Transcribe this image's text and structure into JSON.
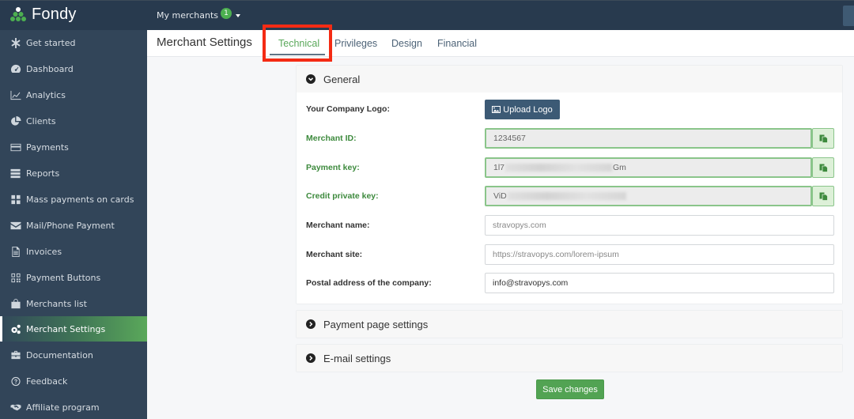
{
  "app": {
    "brand": "Fondy",
    "merchants_menu": {
      "label": "My merchants",
      "badge_count": "1"
    }
  },
  "sidebar": {
    "items": [
      {
        "label": "Get started",
        "icon": "asterisk-icon"
      },
      {
        "label": "Dashboard",
        "icon": "dashboard-gauge-icon"
      },
      {
        "label": "Analytics",
        "icon": "line-chart-icon"
      },
      {
        "label": "Clients",
        "icon": "pie-chart-icon"
      },
      {
        "label": "Payments",
        "icon": "credit-card-icon"
      },
      {
        "label": "Reports",
        "icon": "reports-icon"
      },
      {
        "label": "Mass payments on cards",
        "icon": "grid-icon"
      },
      {
        "label": "Mail/Phone Payment",
        "icon": "envelope-icon"
      },
      {
        "label": "Invoices",
        "icon": "document-icon"
      },
      {
        "label": "Payment Buttons",
        "icon": "qr-code-icon"
      },
      {
        "label": "Merchants list",
        "icon": "shopping-bag-icon"
      },
      {
        "label": "Merchant Settings",
        "icon": "gears-icon",
        "active": true
      },
      {
        "label": "Documentation",
        "icon": "briefcase-icon"
      },
      {
        "label": "Feedback",
        "icon": "question-circle-icon"
      },
      {
        "label": "Affiliate program",
        "icon": "handshake-icon"
      }
    ]
  },
  "page": {
    "title": "Merchant Settings",
    "tabs": [
      {
        "label": "Technical",
        "active": true
      },
      {
        "label": "Privileges"
      },
      {
        "label": "Design"
      },
      {
        "label": "Financial"
      }
    ]
  },
  "general": {
    "title": "General",
    "logo_label": "Your Company Logo:",
    "upload_button": "Upload Logo",
    "merchant_id": {
      "label": "Merchant ID:",
      "value": "1234567"
    },
    "payment_key": {
      "label": "Payment key:",
      "prefix": "1l7",
      "suffix": "Gm"
    },
    "credit_key": {
      "label": "Credit private key:",
      "prefix": "ViD",
      "suffix": ""
    },
    "merchant_name": {
      "label": "Merchant name:",
      "placeholder": "stravopys.com"
    },
    "merchant_site": {
      "label": "Merchant site:",
      "placeholder": "https://stravopys.com/lorem-ipsum"
    },
    "postal_address": {
      "label": "Postal address of the company:",
      "value": "info@stravopys.com"
    }
  },
  "sections": {
    "payment_page": "Payment page settings",
    "email": "E-mail settings"
  },
  "actions": {
    "save": "Save changes"
  },
  "colors": {
    "header_bg": "#283a4e",
    "sidebar_bg": "#324559",
    "accent_green": "#5aa85a",
    "primary_button": "#3c5a75",
    "highlight": "#f42b14"
  }
}
